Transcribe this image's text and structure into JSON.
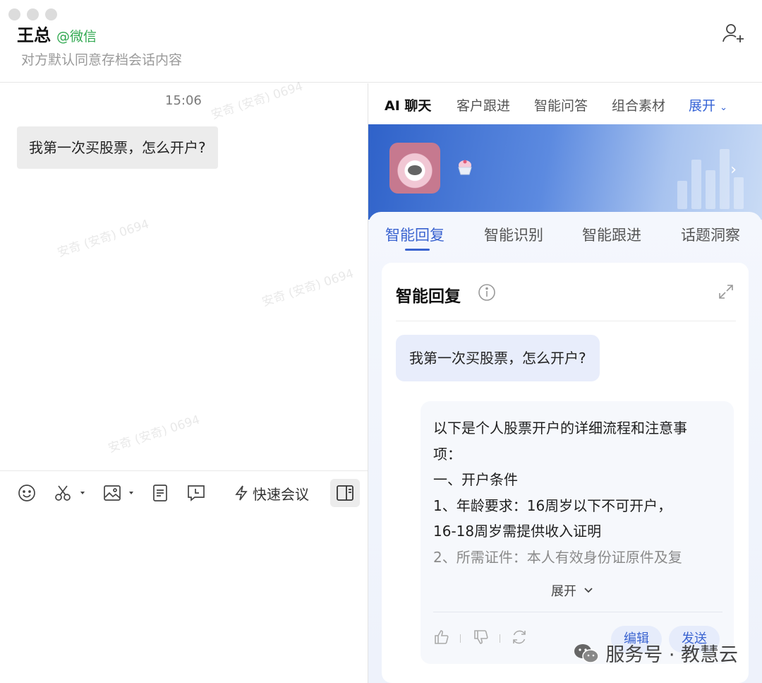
{
  "header": {
    "contact_name": "王总",
    "contact_tag": "@微信",
    "subtitle": "对方默认同意存档会话内容"
  },
  "chat": {
    "time": "15:06",
    "message": "我第一次买股票，怎么开户?",
    "watermark": "安奇 (安奇) 0694"
  },
  "toolbar": {
    "quick_meeting_label": "快速会议"
  },
  "right_panel": {
    "tabs": [
      "AI 聊天",
      "客户跟进",
      "智能问答",
      "组合素材"
    ],
    "tabs_more": "展开",
    "sub_tabs": [
      "智能回复",
      "智能识别",
      "智能跟进",
      "话题洞察"
    ],
    "card": {
      "title": "智能回复",
      "question": "我第一次买股票，怎么开户?",
      "answer_lines": [
        "以下是个人股票开户的详细流程和注意事",
        "项：",
        "一、开户条件",
        "1、年龄要求：16周岁以下不可开户，",
        "16-18周岁需提供收入证明",
        "2、所需证件：本人有效身份证原件及复"
      ],
      "expand_label": "展开",
      "edit_label": "编辑",
      "send_label": "发送"
    }
  },
  "brand": {
    "text": "服务号 · 教慧云"
  },
  "colors": {
    "accent": "#3a63d0",
    "wechat_green": "#2fa84f"
  }
}
